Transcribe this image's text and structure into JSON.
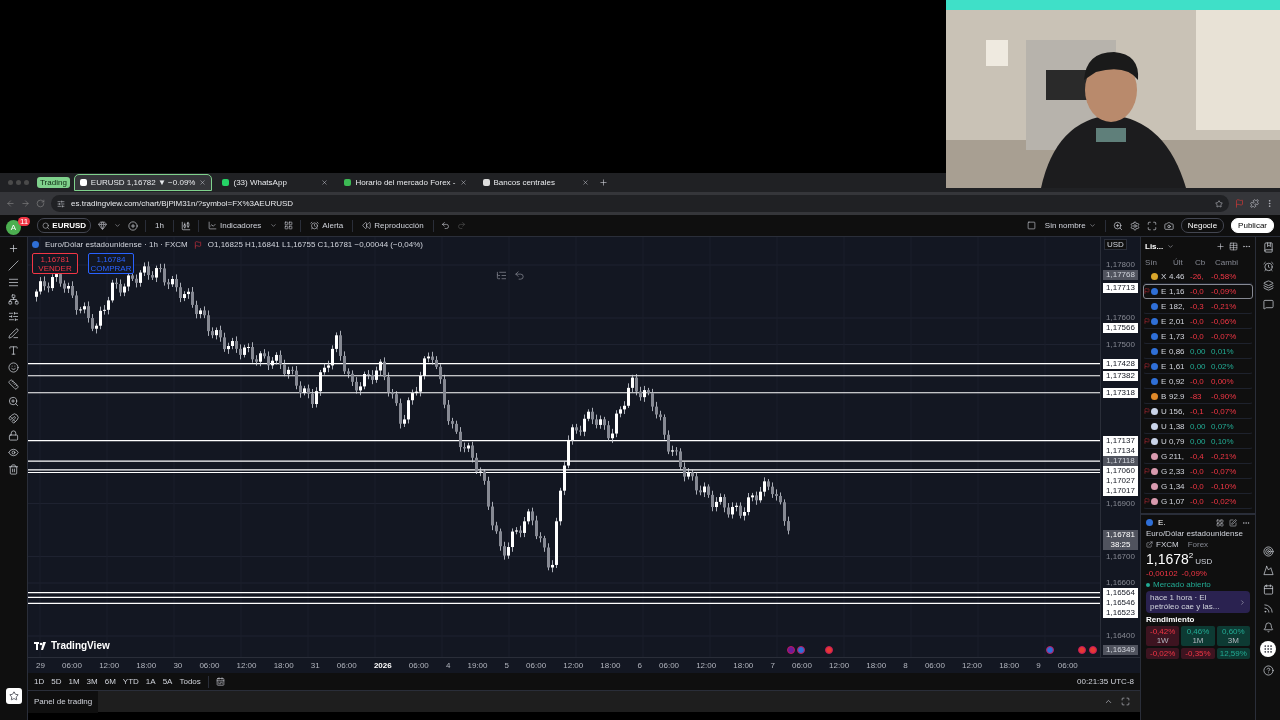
{
  "browser": {
    "tab_group": "Trading",
    "tabs": [
      {
        "title": "EURUSD 1,16782 ▼ −0.09%",
        "selected": true
      },
      {
        "title": "(33) WhatsApp",
        "selected": false
      },
      {
        "title": "Horario del mercado Forex -",
        "selected": false
      },
      {
        "title": "Bancos centrales",
        "selected": false
      }
    ],
    "url": "es.tradingview.com/chart/BjPlM31n/?symbol=FX%3AEURUSD"
  },
  "toolbar": {
    "avatar": "A",
    "notification_count": "11",
    "symbol": "EURUSD",
    "interval": "1h",
    "buttons": [
      {
        "label": "Indicadores",
        "kind": "indicators"
      },
      {
        "label": "Alerta",
        "kind": "alert"
      },
      {
        "label": "Reproducción",
        "kind": "replay"
      }
    ],
    "layout_name": "Sin nombre",
    "trade_button": "Negocie",
    "publish_button": "Publicar"
  },
  "chart": {
    "title": "Euro/Dólar estadounidense · 1h · FXCM",
    "ohlc": "O1,16825 H1,16841 L1,16755 C1,16781 −0,00044 (−0,04%)",
    "sell": {
      "price": "1,16781",
      "label": "VENDER"
    },
    "buy": {
      "price": "1,16784",
      "label": "COMPRAR"
    },
    "currency": "USD",
    "logo": "TradingView",
    "price_axis": [
      {
        "label": "1,17800",
        "kind": "tick"
      },
      {
        "label": "1,17768",
        "kind": "marker"
      },
      {
        "label": "1,17713",
        "kind": "level"
      },
      {
        "label": "1,17600",
        "kind": "tick"
      },
      {
        "label": "1,17566",
        "kind": "level"
      },
      {
        "label": "1,17500",
        "kind": "tick"
      },
      {
        "label": "1,17428",
        "kind": "line"
      },
      {
        "label": "1,17382",
        "kind": "line"
      },
      {
        "label": "1,17318",
        "kind": "line"
      },
      {
        "label": "1,17137",
        "kind": "line"
      },
      {
        "label": "1,17134",
        "kind": "line"
      },
      {
        "label": "1,17118",
        "kind": "marker"
      },
      {
        "label": "1,17060",
        "kind": "line"
      },
      {
        "label": "1,17027",
        "kind": "line"
      },
      {
        "label": "1,17017",
        "kind": "line"
      },
      {
        "label": "1,16900",
        "kind": "tick"
      },
      {
        "label": "1,16781",
        "kind": "current",
        "sub": "38:25"
      },
      {
        "label": "1,16700",
        "kind": "tick"
      },
      {
        "label": "1,16600",
        "kind": "tick"
      },
      {
        "label": "1,16564",
        "kind": "line"
      },
      {
        "label": "1,16546",
        "kind": "line"
      },
      {
        "label": "1,16523",
        "kind": "line"
      },
      {
        "label": "1,16400",
        "kind": "tick"
      },
      {
        "label": "1,16349",
        "kind": "marker"
      }
    ],
    "time_axis": [
      {
        "label": "29",
        "bold": false
      },
      {
        "label": "06:00",
        "bold": false
      },
      {
        "label": "12:00",
        "bold": false
      },
      {
        "label": "18:00",
        "bold": false
      },
      {
        "label": "30",
        "bold": false
      },
      {
        "label": "06:00",
        "bold": false
      },
      {
        "label": "12:00",
        "bold": false
      },
      {
        "label": "18:00",
        "bold": false
      },
      {
        "label": "31",
        "bold": false
      },
      {
        "label": "06:00",
        "bold": false
      },
      {
        "label": "2026",
        "bold": true
      },
      {
        "label": "06:00",
        "bold": false
      },
      {
        "label": "4",
        "bold": false
      },
      {
        "label": "19:00",
        "bold": false
      },
      {
        "label": "5",
        "bold": false
      },
      {
        "label": "06:00",
        "bold": false
      },
      {
        "label": "12:00",
        "bold": false
      },
      {
        "label": "18:00",
        "bold": false
      },
      {
        "label": "6",
        "bold": false
      },
      {
        "label": "06:00",
        "bold": false
      },
      {
        "label": "12:00",
        "bold": false
      },
      {
        "label": "18:00",
        "bold": false
      },
      {
        "label": "7",
        "bold": false
      },
      {
        "label": "06:00",
        "bold": false
      },
      {
        "label": "12:00",
        "bold": false
      },
      {
        "label": "18:00",
        "bold": false
      },
      {
        "label": "8",
        "bold": false
      },
      {
        "label": "06:00",
        "bold": false
      },
      {
        "label": "12:00",
        "bold": false
      },
      {
        "label": "18:00",
        "bold": false
      },
      {
        "label": "9",
        "bold": false
      },
      {
        "label": "06:00",
        "bold": false
      }
    ]
  },
  "ranges": [
    "1D",
    "5D",
    "1M",
    "3M",
    "6M",
    "YTD",
    "1A",
    "5A",
    "Todos"
  ],
  "clock": "00:21:35 UTC-8",
  "bottom_panel": {
    "tab": "Panel de trading"
  },
  "watchlist": {
    "title": "Lis...",
    "columns": [
      "Sín",
      "Últ",
      "Cb",
      "Cambi"
    ],
    "rows": [
      {
        "symbol": "X",
        "last": "4.46",
        "change": "-26,",
        "change_pct": "-0,58%",
        "negative": true,
        "flagged": false,
        "selected": false,
        "color": "#d9a62c"
      },
      {
        "symbol": "E",
        "last": "1,16",
        "change": "-0,0",
        "change_pct": "-0,09%",
        "negative": true,
        "flagged": true,
        "selected": true,
        "color": "#2f6fd6"
      },
      {
        "symbol": "E",
        "last": "182,",
        "change": "-0,3",
        "change_pct": "-0,21%",
        "negative": true,
        "flagged": false,
        "selected": false,
        "color": "#2f6fd6"
      },
      {
        "symbol": "E",
        "last": "2,01",
        "change": "-0,0",
        "change_pct": "-0,06%",
        "negative": true,
        "flagged": true,
        "selected": false,
        "color": "#2f6fd6"
      },
      {
        "symbol": "E",
        "last": "1,73",
        "change": "-0,0",
        "change_pct": "-0,07%",
        "negative": true,
        "flagged": false,
        "selected": false,
        "color": "#2f6fd6"
      },
      {
        "symbol": "E",
        "last": "0,86",
        "change": "0,00",
        "change_pct": "0,01%",
        "negative": false,
        "flagged": false,
        "selected": false,
        "color": "#2f6fd6"
      },
      {
        "symbol": "E",
        "last": "1,61",
        "change": "0,00",
        "change_pct": "0,02%",
        "negative": false,
        "flagged": true,
        "selected": false,
        "color": "#2f6fd6"
      },
      {
        "symbol": "E",
        "last": "0,92",
        "change": "-0,0",
        "change_pct": "0,00%",
        "negative": true,
        "flagged": false,
        "selected": false,
        "color": "#2f6fd6"
      },
      {
        "symbol": "B",
        "last": "92.9",
        "change": "-83",
        "change_pct": "-0,90%",
        "negative": true,
        "flagged": false,
        "selected": false,
        "color": "#e08a2a"
      },
      {
        "symbol": "U",
        "last": "156,",
        "change": "-0,1",
        "change_pct": "-0,07%",
        "negative": true,
        "flagged": true,
        "selected": false,
        "color": "#c9d3e8"
      },
      {
        "symbol": "U",
        "last": "1,38",
        "change": "0,00",
        "change_pct": "0,07%",
        "negative": false,
        "flagged": false,
        "selected": false,
        "color": "#c9d3e8"
      },
      {
        "symbol": "U",
        "last": "0,79",
        "change": "0,00",
        "change_pct": "0,10%",
        "negative": false,
        "flagged": true,
        "selected": false,
        "color": "#c9d3e8"
      },
      {
        "symbol": "G",
        "last": "211,",
        "change": "-0,4",
        "change_pct": "-0,21%",
        "negative": true,
        "flagged": false,
        "selected": false,
        "color": "#d99aae"
      },
      {
        "symbol": "G",
        "last": "2,33",
        "change": "-0,0",
        "change_pct": "-0,07%",
        "negative": true,
        "flagged": true,
        "selected": false,
        "color": "#d99aae"
      },
      {
        "symbol": "G",
        "last": "1,34",
        "change": "-0,0",
        "change_pct": "-0,10%",
        "negative": true,
        "flagged": false,
        "selected": false,
        "color": "#d99aae"
      },
      {
        "symbol": "G",
        "last": "1,07",
        "change": "-0,0",
        "change_pct": "-0,02%",
        "negative": true,
        "flagged": true,
        "selected": false,
        "color": "#d99aae"
      }
    ]
  },
  "details": {
    "symbol": "E.",
    "name": "Euro/Dólar estadounidense",
    "exchange": "FXCM",
    "type": "Forex",
    "price": "1,1678$^{2}$",
    "currency": "USD",
    "change": "-0,00102",
    "change_pct": "-0,09%",
    "negative": true,
    "market_open": true,
    "market_status": "Mercado abierto",
    "news": "hace 1 hora · El petróleo cae y las...",
    "performance_title": "Rendimiento",
    "performance": [
      {
        "value": "-0,42%",
        "period": "1W",
        "negative": true
      },
      {
        "value": "0,46%",
        "period": "1M",
        "negative": false
      },
      {
        "value": "0,60%",
        "period": "3M",
        "negative": false
      },
      {
        "value": "-0,02%",
        "negative": true
      },
      {
        "value": "-0,35%",
        "negative": true
      },
      {
        "value": "12,59%",
        "negative": false
      }
    ]
  }
}
